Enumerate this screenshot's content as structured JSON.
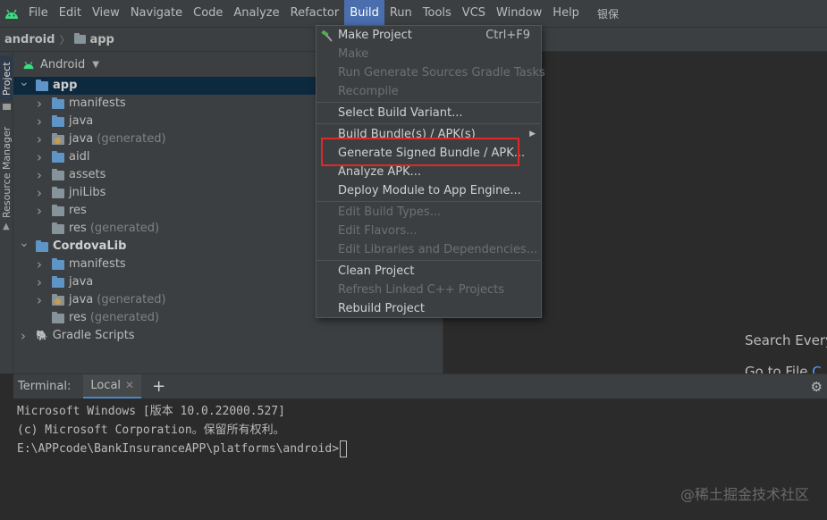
{
  "menubar": {
    "items": [
      "File",
      "Edit",
      "View",
      "Navigate",
      "Code",
      "Analyze",
      "Refactor",
      "Build",
      "Run",
      "Tools",
      "VCS",
      "Window",
      "Help"
    ],
    "active_index": 7,
    "extra": "银保"
  },
  "breadcrumb": {
    "root": "android",
    "module": "app"
  },
  "side_stripe": {
    "project_tab": "Project",
    "resource_tab": "Resource Manager"
  },
  "project_panel": {
    "view_selector": "Android",
    "tree": [
      {
        "label": "app",
        "suffix": "",
        "level": 0,
        "expanded": true,
        "kind": "module",
        "selected": true
      },
      {
        "label": "manifests",
        "suffix": "",
        "level": 1,
        "expanded": false,
        "kind": "folder-blue"
      },
      {
        "label": "java",
        "suffix": "",
        "level": 1,
        "expanded": false,
        "kind": "folder-blue"
      },
      {
        "label": "java",
        "suffix": "(generated)",
        "level": 1,
        "expanded": false,
        "kind": "folder-gen"
      },
      {
        "label": "aidl",
        "suffix": "",
        "level": 1,
        "expanded": false,
        "kind": "folder-blue"
      },
      {
        "label": "assets",
        "suffix": "",
        "level": 1,
        "expanded": false,
        "kind": "folder-gray"
      },
      {
        "label": "jniLibs",
        "suffix": "",
        "level": 1,
        "expanded": false,
        "kind": "folder-gray"
      },
      {
        "label": "res",
        "suffix": "",
        "level": 1,
        "expanded": false,
        "kind": "folder-gray"
      },
      {
        "label": "res",
        "suffix": "(generated)",
        "level": 1,
        "expanded": null,
        "kind": "folder-gray"
      },
      {
        "label": "CordovaLib",
        "suffix": "",
        "level": 0,
        "expanded": true,
        "kind": "library"
      },
      {
        "label": "manifests",
        "suffix": "",
        "level": 1,
        "expanded": false,
        "kind": "folder-blue"
      },
      {
        "label": "java",
        "suffix": "",
        "level": 1,
        "expanded": false,
        "kind": "folder-blue"
      },
      {
        "label": "java",
        "suffix": "(generated)",
        "level": 1,
        "expanded": false,
        "kind": "folder-gen"
      },
      {
        "label": "res",
        "suffix": "(generated)",
        "level": 1,
        "expanded": null,
        "kind": "folder-gray"
      },
      {
        "label": "Gradle Scripts",
        "suffix": "",
        "level": 0,
        "expanded": false,
        "kind": "gradle"
      }
    ]
  },
  "editor_hints": {
    "search_everywhere": "Search Every",
    "goto_file": "Go to File",
    "goto_file_key": "C"
  },
  "build_menu": {
    "groups": [
      [
        {
          "label": "Make Project",
          "shortcut": "Ctrl+F9",
          "enabled": true,
          "icon": "hammer-icon"
        },
        {
          "label": "Make",
          "enabled": false
        },
        {
          "label": "Run Generate Sources Gradle Tasks",
          "enabled": false
        },
        {
          "label": "Recompile",
          "enabled": false
        }
      ],
      [
        {
          "label": "Select Build Variant...",
          "enabled": true
        }
      ],
      [
        {
          "label": "Build Bundle(s) / APK(s)",
          "enabled": true,
          "submenu": true
        },
        {
          "label": "Generate Signed Bundle / APK...",
          "enabled": true,
          "highlighted": true
        },
        {
          "label": "Analyze APK...",
          "enabled": true
        },
        {
          "label": "Deploy Module to App Engine...",
          "enabled": true
        }
      ],
      [
        {
          "label": "Edit Build Types...",
          "enabled": false
        },
        {
          "label": "Edit Flavors...",
          "enabled": false
        },
        {
          "label": "Edit Libraries and Dependencies...",
          "enabled": false
        }
      ],
      [
        {
          "label": "Clean Project",
          "enabled": true
        },
        {
          "label": "Refresh Linked C++ Projects",
          "enabled": false
        },
        {
          "label": "Rebuild Project",
          "enabled": true
        }
      ]
    ],
    "highlight_color": "#e02828"
  },
  "terminal": {
    "title": "Terminal:",
    "tab_label": "Local",
    "lines": [
      "Microsoft Windows [版本 10.0.22000.527]",
      "(c) Microsoft Corporation。保留所有权利。",
      "E:\\APPcode\\BankInsuranceAPP\\platforms\\android>"
    ]
  },
  "watermark": "@稀土掘金技术社区",
  "colors": {
    "accent": "#4b6eaf",
    "selection": "#0d293e",
    "panel_bg": "#3c3f41",
    "editor_bg": "#2b2b2b"
  }
}
